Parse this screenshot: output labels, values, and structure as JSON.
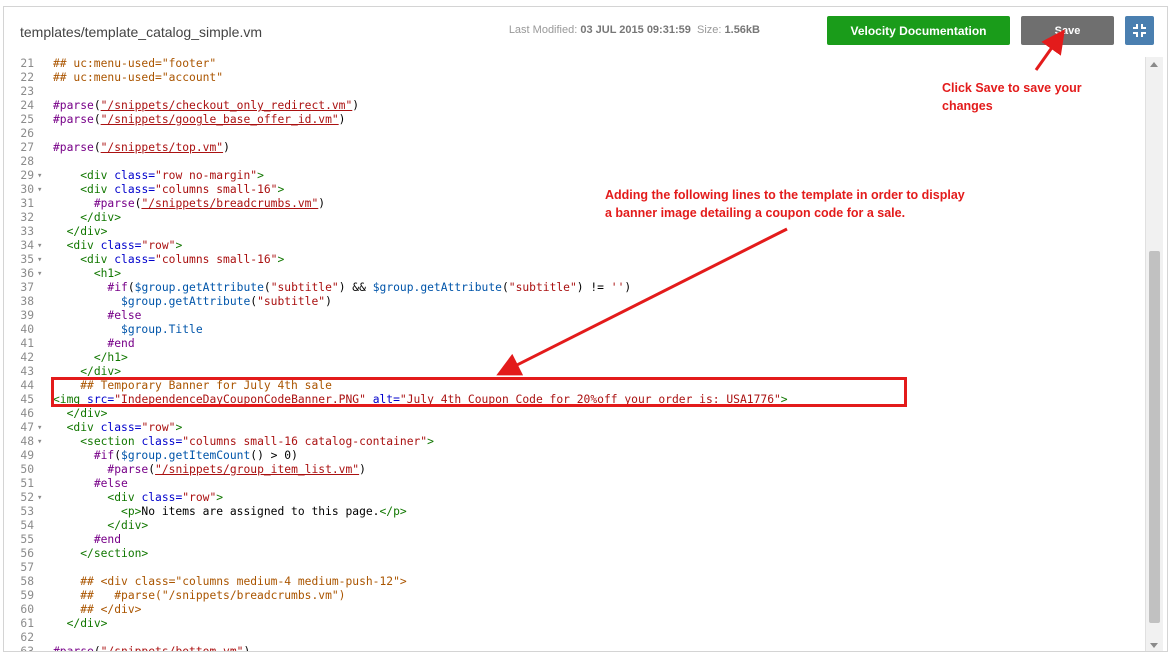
{
  "header": {
    "file_path": "templates/template_catalog_simple.vm",
    "last_modified_label": "Last Modified:",
    "last_modified_value": "03 JUL 2015 09:31:59",
    "size_label": "Size:",
    "size_value": "1.56kB",
    "docs_button": "Velocity Documentation",
    "save_button": "Save"
  },
  "annotations": {
    "save_note_line1": "Click Save to save your",
    "save_note_line2": "changes",
    "banner_note_line1": "Adding the following lines to the template in order to display",
    "banner_note_line2": "a banner image detailing a coupon code for a sale."
  },
  "colors": {
    "annotation": "#e31b1b",
    "docs_button": "#1a9c1a",
    "save_button": "#6f6f6f",
    "expand_button": "#4a7fb0"
  },
  "editor": {
    "lines": [
      {
        "n": "21",
        "fold": false,
        "segs": [
          [
            "cm",
            "## uc:menu-used=\"footer\""
          ]
        ]
      },
      {
        "n": "22",
        "fold": false,
        "segs": [
          [
            "cm",
            "## uc:menu-used=\"account\""
          ]
        ]
      },
      {
        "n": "23",
        "fold": false,
        "segs": []
      },
      {
        "n": "24",
        "fold": false,
        "segs": [
          [
            "kw",
            "#parse"
          ],
          [
            "txt",
            "("
          ],
          [
            "lnk",
            "\"/snippets/checkout_only_redirect.vm\""
          ],
          [
            "txt",
            ")"
          ]
        ]
      },
      {
        "n": "25",
        "fold": false,
        "segs": [
          [
            "kw",
            "#parse"
          ],
          [
            "txt",
            "("
          ],
          [
            "lnk",
            "\"/snippets/google_base_offer_id.vm\""
          ],
          [
            "txt",
            ")"
          ]
        ]
      },
      {
        "n": "26",
        "fold": false,
        "segs": []
      },
      {
        "n": "27",
        "fold": false,
        "segs": [
          [
            "kw",
            "#parse"
          ],
          [
            "txt",
            "("
          ],
          [
            "lnk",
            "\"/snippets/top.vm\""
          ],
          [
            "txt",
            ")"
          ]
        ]
      },
      {
        "n": "28",
        "fold": false,
        "segs": []
      },
      {
        "n": "29",
        "fold": true,
        "segs": [
          [
            "txt",
            "    "
          ],
          [
            "tag",
            "<div "
          ],
          [
            "attr",
            "class="
          ],
          [
            "str",
            "\"row no-margin\""
          ],
          [
            "tag",
            ">"
          ]
        ]
      },
      {
        "n": "30",
        "fold": true,
        "segs": [
          [
            "txt",
            "    "
          ],
          [
            "tag",
            "<div "
          ],
          [
            "attr",
            "class="
          ],
          [
            "str",
            "\"columns small-16\""
          ],
          [
            "tag",
            ">"
          ]
        ]
      },
      {
        "n": "31",
        "fold": false,
        "segs": [
          [
            "txt",
            "      "
          ],
          [
            "kw",
            "#parse"
          ],
          [
            "txt",
            "("
          ],
          [
            "lnk",
            "\"/snippets/breadcrumbs.vm\""
          ],
          [
            "txt",
            ")"
          ]
        ]
      },
      {
        "n": "32",
        "fold": false,
        "segs": [
          [
            "txt",
            "    "
          ],
          [
            "tag",
            "</div>"
          ]
        ]
      },
      {
        "n": "33",
        "fold": false,
        "segs": [
          [
            "txt",
            "  "
          ],
          [
            "tag",
            "</div>"
          ]
        ]
      },
      {
        "n": "34",
        "fold": true,
        "segs": [
          [
            "txt",
            "  "
          ],
          [
            "tag",
            "<div "
          ],
          [
            "attr",
            "class="
          ],
          [
            "str",
            "\"row\""
          ],
          [
            "tag",
            ">"
          ]
        ]
      },
      {
        "n": "35",
        "fold": true,
        "segs": [
          [
            "txt",
            "    "
          ],
          [
            "tag",
            "<div "
          ],
          [
            "attr",
            "class="
          ],
          [
            "str",
            "\"columns small-16\""
          ],
          [
            "tag",
            ">"
          ]
        ]
      },
      {
        "n": "36",
        "fold": true,
        "segs": [
          [
            "txt",
            "      "
          ],
          [
            "tag",
            "<h1>"
          ]
        ]
      },
      {
        "n": "37",
        "fold": false,
        "segs": [
          [
            "txt",
            "        "
          ],
          [
            "kw",
            "#if"
          ],
          [
            "txt",
            "("
          ],
          [
            "var",
            "$group.getAttribute"
          ],
          [
            "txt",
            "("
          ],
          [
            "str",
            "\"subtitle\""
          ],
          [
            "txt",
            ") && "
          ],
          [
            "var",
            "$group.getAttribute"
          ],
          [
            "txt",
            "("
          ],
          [
            "str",
            "\"subtitle\""
          ],
          [
            "txt",
            ") != "
          ],
          [
            "str",
            "''"
          ],
          [
            "txt",
            ")"
          ]
        ]
      },
      {
        "n": "38",
        "fold": false,
        "segs": [
          [
            "txt",
            "          "
          ],
          [
            "var",
            "$group.getAttribute"
          ],
          [
            "txt",
            "("
          ],
          [
            "str",
            "\"subtitle\""
          ],
          [
            "txt",
            ")"
          ]
        ]
      },
      {
        "n": "39",
        "fold": false,
        "segs": [
          [
            "txt",
            "        "
          ],
          [
            "kw",
            "#else"
          ]
        ]
      },
      {
        "n": "40",
        "fold": false,
        "segs": [
          [
            "txt",
            "          "
          ],
          [
            "var",
            "$group.Title"
          ]
        ]
      },
      {
        "n": "41",
        "fold": false,
        "segs": [
          [
            "txt",
            "        "
          ],
          [
            "kw",
            "#end"
          ]
        ]
      },
      {
        "n": "42",
        "fold": false,
        "segs": [
          [
            "txt",
            "      "
          ],
          [
            "tag",
            "</h1>"
          ]
        ]
      },
      {
        "n": "43",
        "fold": false,
        "segs": [
          [
            "txt",
            "    "
          ],
          [
            "tag",
            "</div>"
          ]
        ]
      },
      {
        "n": "44",
        "fold": false,
        "segs": [
          [
            "txt",
            "    "
          ],
          [
            "cm",
            "## Temporary Banner for July 4th sale"
          ]
        ]
      },
      {
        "n": "45",
        "fold": false,
        "segs": [
          [
            "tag",
            "<img "
          ],
          [
            "attr",
            "src="
          ],
          [
            "str",
            "\"IndependenceDayCouponCodeBanner.PNG\""
          ],
          [
            "txt",
            " "
          ],
          [
            "attr",
            "alt="
          ],
          [
            "str",
            "\"July 4th Coupon Code for 20%off your order is: USA1776\""
          ],
          [
            "tag",
            ">"
          ]
        ]
      },
      {
        "n": "46",
        "fold": false,
        "segs": [
          [
            "txt",
            "  "
          ],
          [
            "tag",
            "</div>"
          ]
        ]
      },
      {
        "n": "47",
        "fold": true,
        "segs": [
          [
            "txt",
            "  "
          ],
          [
            "tag",
            "<div "
          ],
          [
            "attr",
            "class="
          ],
          [
            "str",
            "\"row\""
          ],
          [
            "tag",
            ">"
          ]
        ]
      },
      {
        "n": "48",
        "fold": true,
        "segs": [
          [
            "txt",
            "    "
          ],
          [
            "tag",
            "<section "
          ],
          [
            "attr",
            "class="
          ],
          [
            "str",
            "\"columns small-16 catalog-container\""
          ],
          [
            "tag",
            ">"
          ]
        ]
      },
      {
        "n": "49",
        "fold": false,
        "segs": [
          [
            "txt",
            "      "
          ],
          [
            "kw",
            "#if"
          ],
          [
            "txt",
            "("
          ],
          [
            "var",
            "$group.getItemCount"
          ],
          [
            "txt",
            "() > 0)"
          ]
        ]
      },
      {
        "n": "50",
        "fold": false,
        "segs": [
          [
            "txt",
            "        "
          ],
          [
            "kw",
            "#parse"
          ],
          [
            "txt",
            "("
          ],
          [
            "lnk",
            "\"/snippets/group_item_list.vm\""
          ],
          [
            "txt",
            ")"
          ]
        ]
      },
      {
        "n": "51",
        "fold": false,
        "segs": [
          [
            "txt",
            "      "
          ],
          [
            "kw",
            "#else"
          ]
        ]
      },
      {
        "n": "52",
        "fold": true,
        "segs": [
          [
            "txt",
            "        "
          ],
          [
            "tag",
            "<div "
          ],
          [
            "attr",
            "class="
          ],
          [
            "str",
            "\"row\""
          ],
          [
            "tag",
            ">"
          ]
        ]
      },
      {
        "n": "53",
        "fold": false,
        "segs": [
          [
            "txt",
            "          "
          ],
          [
            "tag",
            "<p>"
          ],
          [
            "txt",
            "No items are assigned to this page."
          ],
          [
            "tag",
            "</p>"
          ]
        ]
      },
      {
        "n": "54",
        "fold": false,
        "segs": [
          [
            "txt",
            "        "
          ],
          [
            "tag",
            "</div>"
          ]
        ]
      },
      {
        "n": "55",
        "fold": false,
        "segs": [
          [
            "txt",
            "      "
          ],
          [
            "kw",
            "#end"
          ]
        ]
      },
      {
        "n": "56",
        "fold": false,
        "segs": [
          [
            "txt",
            "    "
          ],
          [
            "tag",
            "</section>"
          ]
        ]
      },
      {
        "n": "57",
        "fold": false,
        "segs": []
      },
      {
        "n": "58",
        "fold": false,
        "segs": [
          [
            "txt",
            "    "
          ],
          [
            "cm",
            "## <div class=\"columns medium-4 medium-push-12\">"
          ]
        ]
      },
      {
        "n": "59",
        "fold": false,
        "segs": [
          [
            "txt",
            "    "
          ],
          [
            "cm",
            "##   #parse(\"/snippets/breadcrumbs.vm\")"
          ]
        ]
      },
      {
        "n": "60",
        "fold": false,
        "segs": [
          [
            "txt",
            "    "
          ],
          [
            "cm",
            "## </div>"
          ]
        ]
      },
      {
        "n": "61",
        "fold": false,
        "segs": [
          [
            "txt",
            "  "
          ],
          [
            "tag",
            "</div>"
          ]
        ]
      },
      {
        "n": "62",
        "fold": false,
        "segs": []
      },
      {
        "n": "63",
        "fold": false,
        "segs": [
          [
            "kw",
            "#parse"
          ],
          [
            "txt",
            "("
          ],
          [
            "lnk",
            "\"/snippets/bottom.vm\""
          ],
          [
            "txt",
            ")"
          ]
        ]
      }
    ]
  }
}
